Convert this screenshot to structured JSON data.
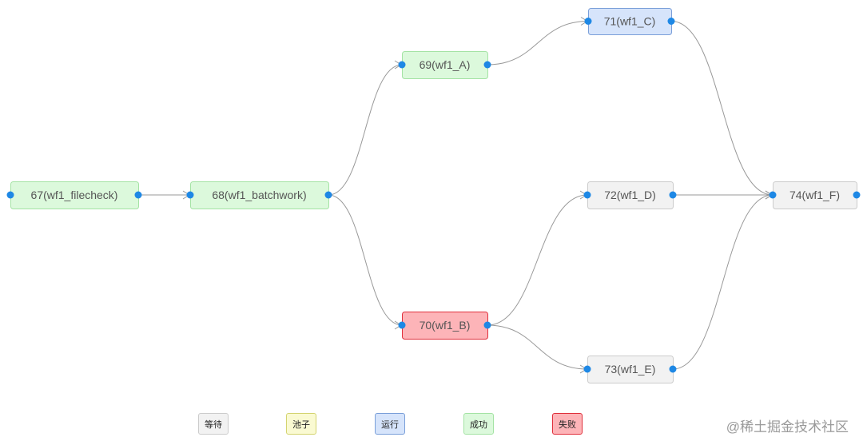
{
  "statuses": {
    "waiting": {
      "label": "等待",
      "fill": "#f2f2f2",
      "stroke": "#cccccc"
    },
    "pool": {
      "label": "池子",
      "fill": "#fafad2",
      "stroke": "#d4d470"
    },
    "running": {
      "label": "运行",
      "fill": "#d6e4fb",
      "stroke": "#7a9fd9"
    },
    "success": {
      "label": "成功",
      "fill": "#dcf9dc",
      "stroke": "#a4e3a4"
    },
    "failed": {
      "label": "失败",
      "fill": "#fdb4b8",
      "stroke": "#e0303c"
    }
  },
  "legend": [
    "waiting",
    "pool",
    "running",
    "success",
    "failed"
  ],
  "nodes": [
    {
      "id": "67",
      "label": "67(wf1_filecheck)",
      "status": "success"
    },
    {
      "id": "68",
      "label": "68(wf1_batchwork)",
      "status": "success"
    },
    {
      "id": "69",
      "label": "69(wf1_A)",
      "status": "success"
    },
    {
      "id": "70",
      "label": "70(wf1_B)",
      "status": "failed"
    },
    {
      "id": "71",
      "label": "71(wf1_C)",
      "status": "running"
    },
    {
      "id": "72",
      "label": "72(wf1_D)",
      "status": "waiting"
    },
    {
      "id": "73",
      "label": "73(wf1_E)",
      "status": "waiting"
    },
    {
      "id": "74",
      "label": "74(wf1_F)",
      "status": "waiting"
    }
  ],
  "edges": [
    [
      "67",
      "68"
    ],
    [
      "68",
      "69"
    ],
    [
      "68",
      "70"
    ],
    [
      "69",
      "71"
    ],
    [
      "70",
      "72"
    ],
    [
      "70",
      "73"
    ],
    [
      "71",
      "74"
    ],
    [
      "72",
      "74"
    ],
    [
      "73",
      "74"
    ]
  ],
  "colors": {
    "port": "#1e88e5",
    "edge": "#999999",
    "text": "#555555"
  },
  "watermark": "@稀土掘金技术社区"
}
